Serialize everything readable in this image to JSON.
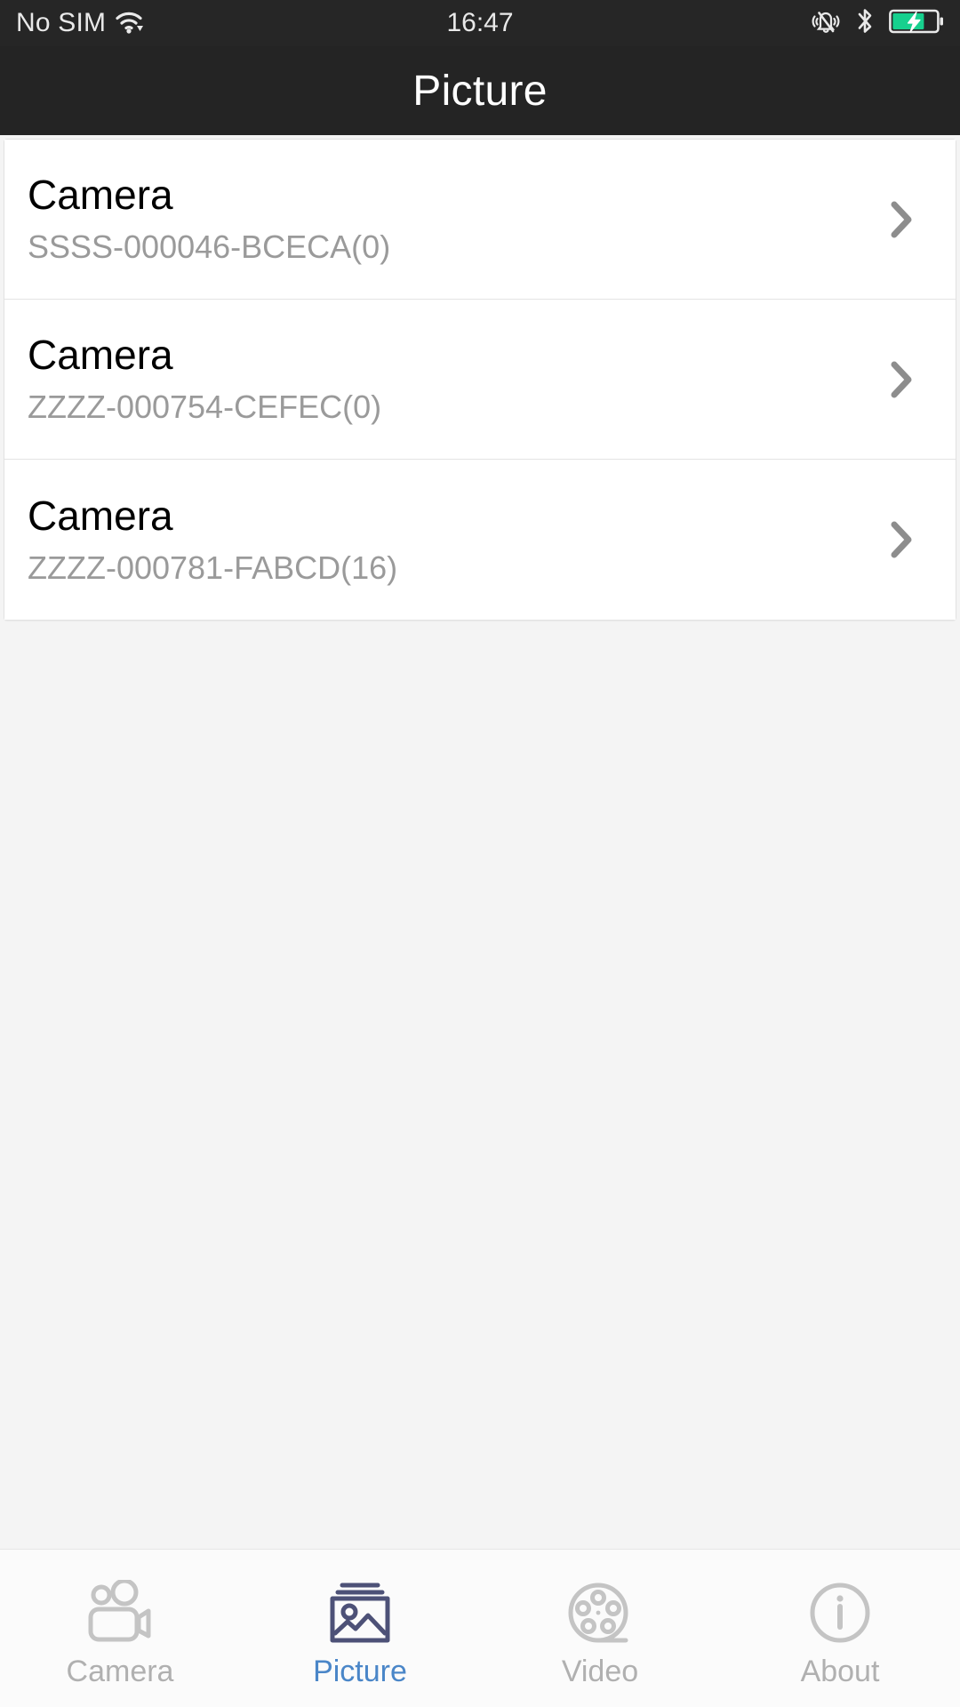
{
  "status_bar": {
    "carrier": "No SIM",
    "time": "16:47",
    "icons": {
      "wifi": "wifi-icon",
      "silent": "bell-silent-icon",
      "bluetooth": "bluetooth-icon",
      "battery": "battery-charging-icon"
    },
    "background": "#262626",
    "text_color": "#e9e9e9",
    "battery_color": "#17d08e"
  },
  "header": {
    "title": "Picture",
    "background": "#242424",
    "text_color": "#ffffff"
  },
  "list": {
    "items": [
      {
        "title": "Camera",
        "subtitle": "SSSS-000046-BCECA(0)",
        "chevron": "chevron-right-icon"
      },
      {
        "title": "Camera",
        "subtitle": "ZZZZ-000754-CEFEC(0)",
        "chevron": "chevron-right-icon"
      },
      {
        "title": "Camera",
        "subtitle": "ZZZZ-000781-FABCD(16)",
        "chevron": "chevron-right-icon"
      }
    ],
    "title_color": "#000000",
    "subtitle_color": "#9a9a9a",
    "card_background": "#ffffff",
    "page_background": "#f4f4f4"
  },
  "tab_bar": {
    "background": "#fbfbfb",
    "inactive_color": "#c4c4c4",
    "inactive_label_color": "#b0b0b0",
    "active_icon_color": "#4d5177",
    "active_label_color": "#4a86c8",
    "tabs": [
      {
        "label": "Camera",
        "icon": "video-camera-icon",
        "active": false
      },
      {
        "label": "Picture",
        "icon": "photo-gallery-icon",
        "active": true
      },
      {
        "label": "Video",
        "icon": "film-reel-icon",
        "active": false
      },
      {
        "label": "About",
        "icon": "info-circle-icon",
        "active": false
      }
    ]
  }
}
